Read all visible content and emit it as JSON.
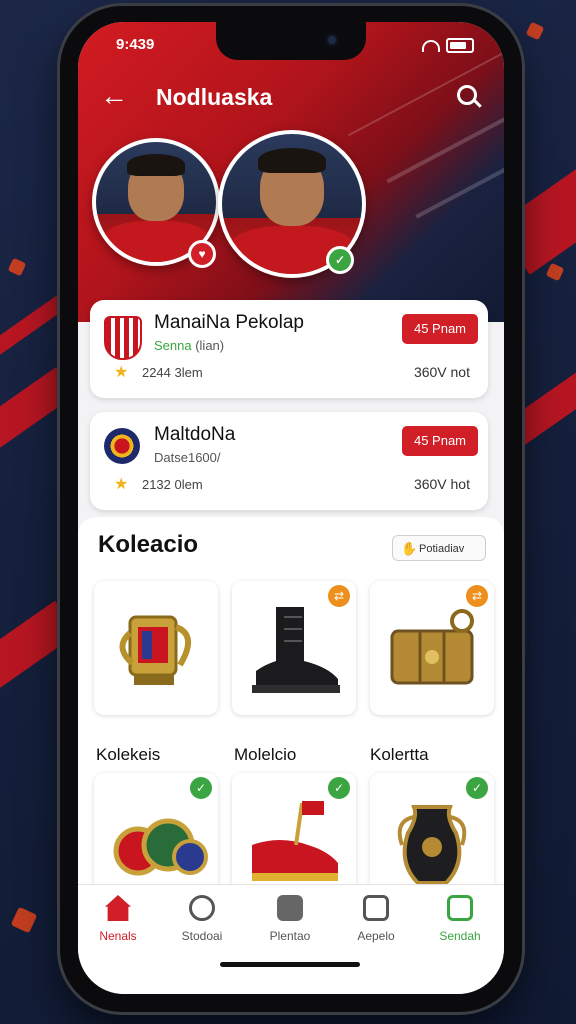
{
  "status": {
    "time": "9:439"
  },
  "header": {
    "back_icon": "arrow-left-icon",
    "title": "Nodluaska",
    "search_icon": "search-icon"
  },
  "clubs": [
    {
      "name": "ManaiNa Pekolap",
      "sub_prefix": "Senna",
      "sub_suffix": "(lian)",
      "stat": "2244 3lem",
      "button": "45 Pnam",
      "value": "360V not"
    },
    {
      "name": "MaltdoNa",
      "sub_prefix": "Datse",
      "sub_suffix": "1600/",
      "stat": "2132 0lem",
      "button": "45 Pnam",
      "value": "360V hot"
    }
  ],
  "collection": {
    "title": "Koleacio",
    "filter_label": "Potiadiav",
    "items": [
      {
        "label": "Kolekeis",
        "icon": "trophy-mug-icon"
      },
      {
        "label": "Molelcio",
        "icon": "boot-icon"
      },
      {
        "label": "Kolertta",
        "icon": "treasure-chest-icon"
      },
      {
        "label": "",
        "icon": "medals-icon"
      },
      {
        "label": "",
        "icon": "shoe-flag-icon"
      },
      {
        "label": "",
        "icon": "vase-icon"
      }
    ]
  },
  "tabs": [
    {
      "label": "Nenals",
      "icon": "home-icon",
      "active": true
    },
    {
      "label": "Stodoai",
      "icon": "badge-icon",
      "active": false
    },
    {
      "label": "Plentao",
      "icon": "chart-icon",
      "active": false
    },
    {
      "label": "Aepelo",
      "icon": "shop-icon",
      "active": false
    },
    {
      "label": "Sendah",
      "icon": "bag-icon",
      "active": false
    }
  ],
  "colors": {
    "primary": "#d01f26",
    "green": "#3aa541",
    "accent": "#f3b21b"
  }
}
